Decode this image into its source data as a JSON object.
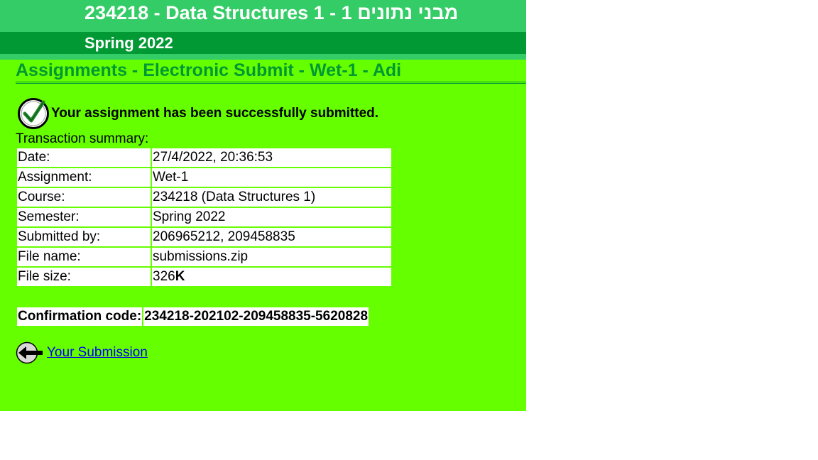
{
  "header": {
    "course_title": "234218 - Data Structures 1 - 1 מבני נתונים",
    "semester": "Spring 2022"
  },
  "page": {
    "heading": "Assignments - Electronic Submit - Wet-1 - Adi"
  },
  "status": {
    "message": "Your assignment has been successfully submitted.",
    "icon": "check-icon"
  },
  "summary": {
    "label": "Transaction summary:",
    "rows": [
      {
        "key": "Date:",
        "value": "27/4/2022, 20:36:53"
      },
      {
        "key": "Assignment:",
        "value": "Wet-1"
      },
      {
        "key": "Course:",
        "value": "234218 (Data Structures 1)"
      },
      {
        "key": "Semester:",
        "value": "Spring 2022"
      },
      {
        "key": "Submitted by:",
        "value": "206965212, 209458835"
      },
      {
        "key": "File name:",
        "value": "submissions.zip"
      },
      {
        "key": "File size:",
        "value": "326",
        "unit": "K"
      }
    ]
  },
  "confirmation": {
    "label": "Confirmation code:",
    "code": "234218-202102-209458835-5620828"
  },
  "navigation": {
    "back_link": "Your Submission",
    "back_icon": "back-arrow-icon"
  },
  "colors": {
    "page_bg": "#66ff00",
    "banner_light": "#33cc66",
    "banner_dark": "#009933",
    "heading": "#009933",
    "link": "#0000ee"
  }
}
